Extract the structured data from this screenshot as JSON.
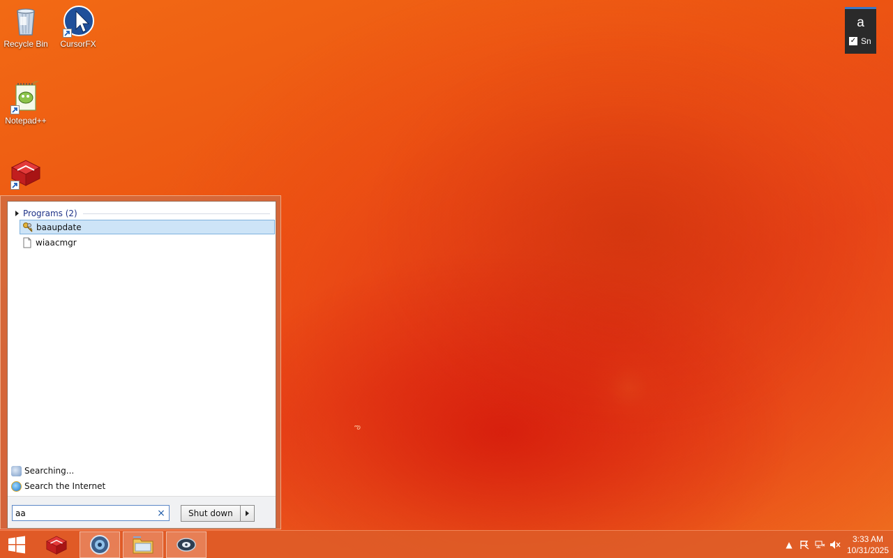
{
  "desktop": {
    "icons": [
      {
        "label": "Recycle Bin",
        "icon": "recycle-bin-icon"
      },
      {
        "label": "CursorFX",
        "icon": "cursorfx-icon"
      },
      {
        "label": "Notepad++",
        "icon": "notepad-plus-plus-icon"
      },
      {
        "label": "",
        "icon": "red-box-app-icon"
      }
    ]
  },
  "gadget": {
    "letter": "a",
    "checkbox_label": "Sn",
    "checked": true
  },
  "start_menu": {
    "results_header": "Programs (2)",
    "results": [
      {
        "label": "baaupdate",
        "icon": "keys-icon",
        "selected": true
      },
      {
        "label": "wiaacmgr",
        "icon": "file-icon",
        "selected": false
      }
    ],
    "searching_label": "Searching...",
    "search_internet_label": "Search the Internet",
    "search_value": "aa",
    "clear_symbol": "×",
    "shutdown_label": "Shut down"
  },
  "taskbar": {
    "buttons": [
      {
        "icon": "red-box-app-icon",
        "active": false
      },
      {
        "icon": "browser-icon",
        "active": true
      },
      {
        "icon": "file-explorer-icon",
        "active": true
      },
      {
        "icon": "media-disc-icon",
        "active": true
      }
    ],
    "tray": {
      "time": "3:33 AM",
      "date": "10/31/2025"
    }
  },
  "colors": {
    "accent": "#3b78c6",
    "selection": "#cde4f7",
    "header_text": "#1e3287"
  }
}
